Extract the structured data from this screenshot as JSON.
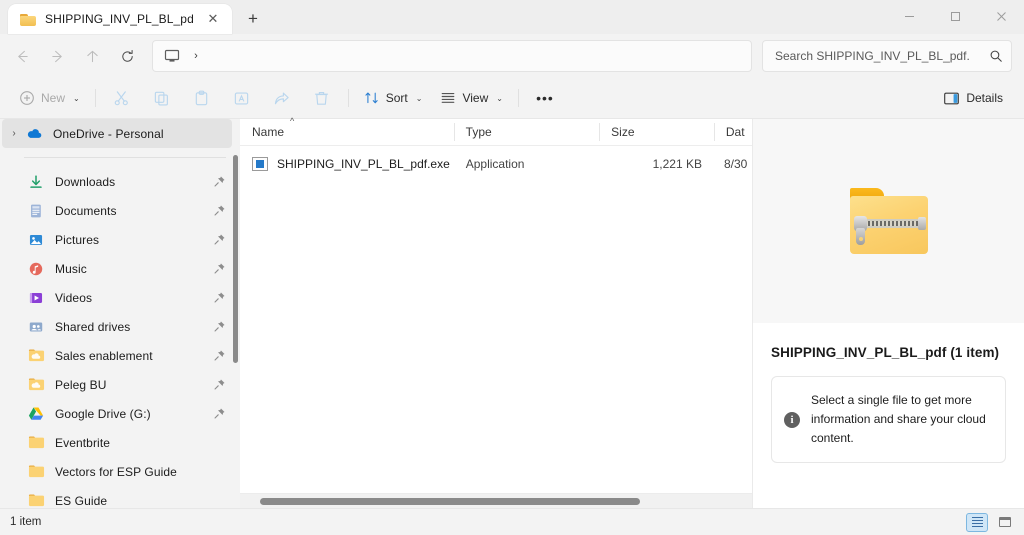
{
  "window": {
    "tab_title": "SHIPPING_INV_PL_BL_pdf.rar",
    "tab_close_label": "✕",
    "new_tab_label": "+",
    "minimize_label": "─",
    "maximize_label": "□",
    "close_label": "✕"
  },
  "address_bar": {
    "back_label": "←",
    "forward_label": "→",
    "up_label": "↑",
    "refresh_label": "↻",
    "breadcrumb_icon": "this-pc-icon",
    "breadcrumb_chevron": "›",
    "search_placeholder": "Search SHIPPING_INV_PL_BL_pdf.",
    "search_value": ""
  },
  "command_bar": {
    "new_label": "New",
    "new_chevron": "⌄",
    "cut_label": "",
    "copy_label": "",
    "paste_label": "",
    "rename_label": "",
    "share_label": "",
    "delete_label": "",
    "sort_label": "Sort",
    "sort_chevron": "⌄",
    "view_label": "View",
    "view_chevron": "⌄",
    "more_label": "•••",
    "details_label": "Details"
  },
  "sidebar": {
    "items": [
      {
        "label": "OneDrive - Personal",
        "icon": "onedrive-cloud-icon",
        "expander": "›",
        "pinned": false,
        "selected": true,
        "indent": 0
      },
      {
        "label": "Downloads",
        "icon": "download-arrow-icon",
        "pinned": true,
        "selected": false,
        "indent": 1
      },
      {
        "label": "Documents",
        "icon": "documents-icon",
        "pinned": true,
        "selected": false,
        "indent": 1
      },
      {
        "label": "Pictures",
        "icon": "pictures-icon",
        "pinned": true,
        "selected": false,
        "indent": 1
      },
      {
        "label": "Music",
        "icon": "music-note-icon",
        "pinned": true,
        "selected": false,
        "indent": 1
      },
      {
        "label": "Videos",
        "icon": "videos-icon",
        "pinned": true,
        "selected": false,
        "indent": 1
      },
      {
        "label": "Shared drives",
        "icon": "shared-drives-icon",
        "pinned": true,
        "selected": false,
        "indent": 1
      },
      {
        "label": "Sales enablement",
        "icon": "cloud-folder-icon",
        "pinned": true,
        "selected": false,
        "indent": 1
      },
      {
        "label": "Peleg BU",
        "icon": "cloud-folder-icon",
        "pinned": true,
        "selected": false,
        "indent": 1
      },
      {
        "label": "Google Drive (G:)",
        "icon": "google-drive-icon",
        "pinned": true,
        "selected": false,
        "indent": 1
      },
      {
        "label": "Eventbrite",
        "icon": "folder-icon",
        "pinned": false,
        "selected": false,
        "indent": 1
      },
      {
        "label": "Vectors for ESP Guide",
        "icon": "folder-icon",
        "pinned": false,
        "selected": false,
        "indent": 1
      },
      {
        "label": "ES Guide",
        "icon": "folder-icon",
        "pinned": false,
        "selected": false,
        "indent": 1
      }
    ]
  },
  "file_list": {
    "columns": [
      {
        "label": "Name",
        "align": "left",
        "sorted": "ascending"
      },
      {
        "label": "Type",
        "align": "left"
      },
      {
        "label": "Size",
        "align": "right"
      },
      {
        "label": "Dat",
        "align": "left"
      }
    ],
    "rows": [
      {
        "name": "SHIPPING_INV_PL_BL_pdf.exe",
        "icon": "application-exe-icon",
        "type": "Application",
        "size": "1,221 KB",
        "date": "8/30"
      }
    ]
  },
  "preview_pane": {
    "thumbnail_icon": "zipped-folder-icon",
    "title": "SHIPPING_INV_PL_BL_pdf (1 item)",
    "info_icon": "information-icon",
    "info_glyph": "i",
    "info_text": "Select a single file to get more information and share your cloud content."
  },
  "status_bar": {
    "item_count": "1 item",
    "details_view_icon": "details-view-icon",
    "large_icons_view_icon": "large-icons-view-icon"
  },
  "colors": {
    "accent": "#0078d4",
    "chrome": "#f3f3f3",
    "selection": "#e3e3e3",
    "folder_yellow": "#f4c254"
  }
}
